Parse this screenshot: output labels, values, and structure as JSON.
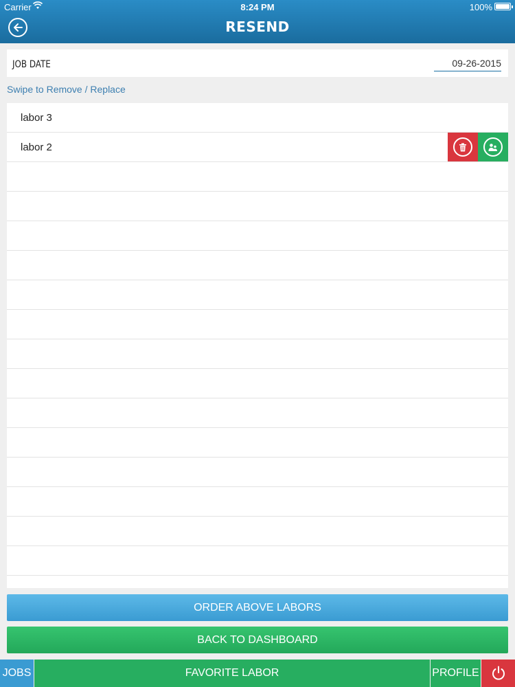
{
  "status_bar": {
    "carrier": "Carrier",
    "time": "8:24 PM",
    "battery": "100%"
  },
  "header": {
    "title": "RESEND",
    "back_icon": "arrow-left-icon"
  },
  "job_date": {
    "label": "JOB DATE",
    "value": "09-26-2015"
  },
  "swipe_hint": "Swipe to Remove / Replace",
  "labors": [
    {
      "name": "labor 3"
    },
    {
      "name": "labor 2"
    }
  ],
  "row_actions": {
    "remove_icon": "trash-icon",
    "replace_icon": "swap-user-icon"
  },
  "buttons": {
    "order": "ORDER ABOVE LABORS",
    "back_to_dashboard": "BACK TO DASHBOARD"
  },
  "tabs": {
    "jobs": "JOBS",
    "favorite_labor": "FAVORITE LABOR",
    "profile": "PROFILE",
    "power_icon": "power-icon"
  },
  "colors": {
    "header": "#1a6c9e",
    "accent_blue": "#3a9bd2",
    "accent_green": "#27ae60",
    "danger_red": "#d9363e"
  }
}
